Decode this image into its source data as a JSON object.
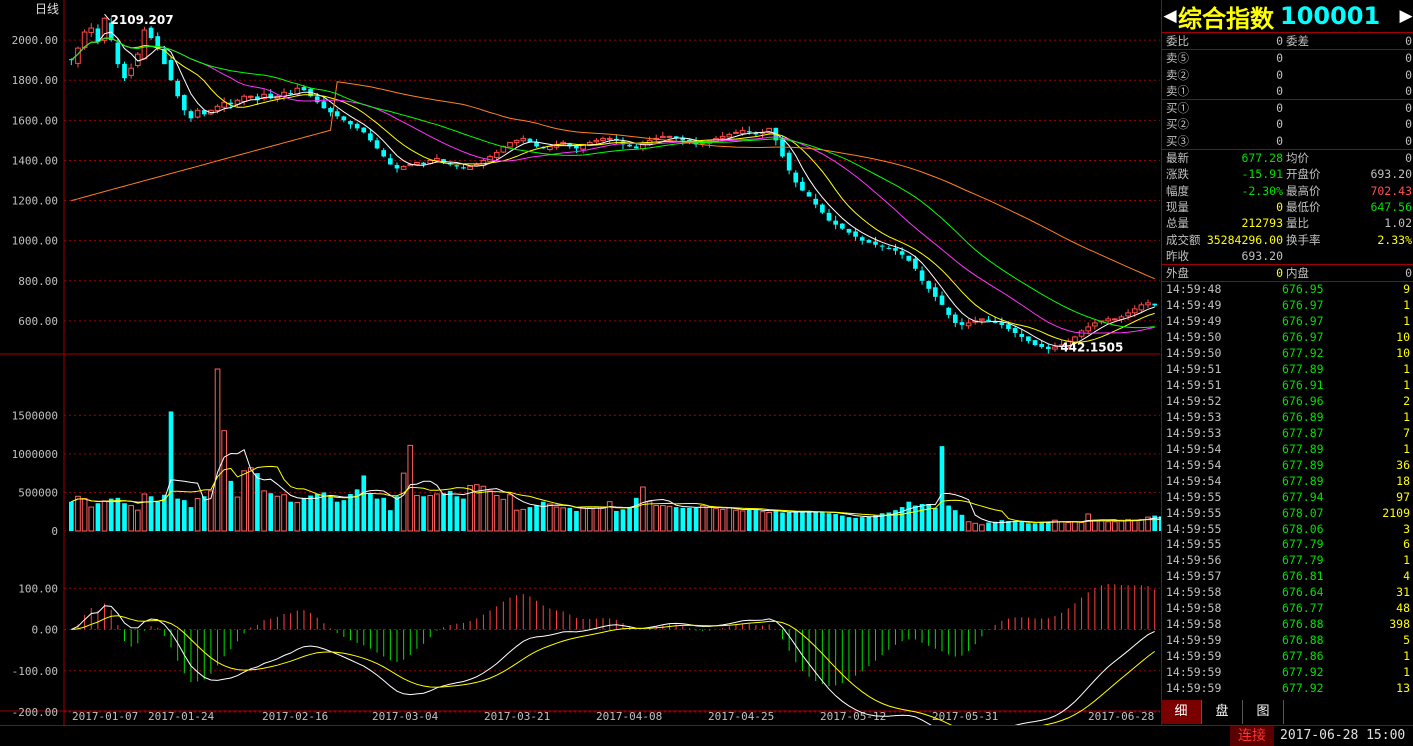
{
  "header": {
    "period_label": "日线"
  },
  "quote": {
    "title": "综合指数",
    "code": "100001",
    "arrow_left": "◀",
    "arrow_right": "▶",
    "order_ratio": {
      "label1": "委比",
      "value1": "0",
      "label2": "委差",
      "value2": "0"
    },
    "sell": [
      {
        "label": "卖⑤",
        "price": "0",
        "volume": "0"
      },
      {
        "label": "卖②",
        "price": "0",
        "volume": "0"
      },
      {
        "label": "卖①",
        "price": "0",
        "volume": "0"
      }
    ],
    "buy": [
      {
        "label": "买①",
        "price": "0",
        "volume": "0"
      },
      {
        "label": "买②",
        "price": "0",
        "volume": "0"
      },
      {
        "label": "买③",
        "price": "0",
        "volume": "0"
      }
    ],
    "stats": [
      {
        "label1": "最新",
        "value1": "677.28",
        "c1": "g",
        "label2": "均价",
        "value2": "0",
        "c2": "w"
      },
      {
        "label1": "涨跌",
        "value1": "-15.91",
        "c1": "g",
        "label2": "开盘价",
        "value2": "693.20",
        "c2": "w"
      },
      {
        "label1": "幅度",
        "value1": "-2.30%",
        "c1": "g",
        "label2": "最高价",
        "value2": "702.43",
        "c2": "r"
      },
      {
        "label1": "现量",
        "value1": "0",
        "c1": "y",
        "label2": "最低价",
        "value2": "647.56",
        "c2": "g"
      },
      {
        "label1": "总量",
        "value1": "212793",
        "c1": "y",
        "label2": "量比",
        "value2": "1.02",
        "c2": "w"
      },
      {
        "label1": "成交额",
        "value1": "35284296.00",
        "c1": "y",
        "label2": "换手率",
        "value2": "2.33%",
        "c2": "y"
      },
      {
        "label1": "昨收",
        "value1": "693.20",
        "c1": "w",
        "label2": "",
        "value2": "",
        "c2": "w"
      }
    ],
    "outer": {
      "label1": "外盘",
      "value1": "0",
      "label2": "内盘",
      "value2": "0"
    }
  },
  "ticks": [
    {
      "time": "14:59:48",
      "price": "676.95",
      "volume": "9"
    },
    {
      "time": "14:59:49",
      "price": "676.97",
      "volume": "1"
    },
    {
      "time": "14:59:49",
      "price": "676.97",
      "volume": "1"
    },
    {
      "time": "14:59:50",
      "price": "676.97",
      "volume": "10"
    },
    {
      "time": "14:59:50",
      "price": "677.92",
      "volume": "10"
    },
    {
      "time": "14:59:51",
      "price": "677.89",
      "volume": "1"
    },
    {
      "time": "14:59:51",
      "price": "676.91",
      "volume": "1"
    },
    {
      "time": "14:59:52",
      "price": "676.96",
      "volume": "2"
    },
    {
      "time": "14:59:53",
      "price": "676.89",
      "volume": "1"
    },
    {
      "time": "14:59:53",
      "price": "677.87",
      "volume": "7"
    },
    {
      "time": "14:59:54",
      "price": "677.89",
      "volume": "1"
    },
    {
      "time": "14:59:54",
      "price": "677.89",
      "volume": "36"
    },
    {
      "time": "14:59:54",
      "price": "677.89",
      "volume": "18"
    },
    {
      "time": "14:59:55",
      "price": "677.94",
      "volume": "97"
    },
    {
      "time": "14:59:55",
      "price": "678.07",
      "volume": "2109"
    },
    {
      "time": "14:59:55",
      "price": "678.06",
      "volume": "3"
    },
    {
      "time": "14:59:55",
      "price": "677.79",
      "volume": "6"
    },
    {
      "time": "14:59:56",
      "price": "677.79",
      "volume": "1"
    },
    {
      "time": "14:59:57",
      "price": "676.81",
      "volume": "4"
    },
    {
      "time": "14:59:58",
      "price": "676.64",
      "volume": "31"
    },
    {
      "time": "14:59:58",
      "price": "676.77",
      "volume": "48"
    },
    {
      "time": "14:59:58",
      "price": "676.88",
      "volume": "398"
    },
    {
      "time": "14:59:59",
      "price": "676.88",
      "volume": "5"
    },
    {
      "time": "14:59:59",
      "price": "677.86",
      "volume": "1"
    },
    {
      "time": "14:59:59",
      "price": "677.92",
      "volume": "1"
    },
    {
      "time": "14:59:59",
      "price": "677.92",
      "volume": "13"
    }
  ],
  "tabs": [
    {
      "label": "细",
      "active": true
    },
    {
      "label": "盘",
      "active": false
    },
    {
      "label": "图",
      "active": false
    }
  ],
  "status": {
    "connection": "连接",
    "datetime": "2017-06-28 15:00"
  },
  "chart_data": {
    "type": "candlestick",
    "date_labels": [
      "2017-01-07",
      "2017-01-24",
      "2017-02-16",
      "2017-03-04",
      "2017-03-21",
      "2017-04-08",
      "2017-04-25",
      "2017-05-12",
      "2017-05-31",
      "2017-06-28"
    ],
    "price": {
      "yticks": [
        "2000.00",
        "1800.00",
        "1600.00",
        "1400.00",
        "1200.00",
        "1000.00",
        "800.00",
        "600.00"
      ],
      "ylim": [
        450,
        2160
      ],
      "max_label": "2109.207",
      "min_label": "442.1505",
      "closes": [
        1900,
        1960,
        2040,
        2060,
        1990,
        2109,
        2000,
        1880,
        1810,
        1860,
        1930,
        2050,
        2010,
        1960,
        1880,
        1800,
        1720,
        1650,
        1610,
        1650,
        1630,
        1650,
        1670,
        1690,
        1680,
        1700,
        1720,
        1720,
        1700,
        1730,
        1710,
        1720,
        1740,
        1730,
        1760,
        1750,
        1720,
        1690,
        1660,
        1640,
        1620,
        1600,
        1580,
        1560,
        1540,
        1500,
        1460,
        1420,
        1380,
        1360,
        1370,
        1380,
        1390,
        1380,
        1400,
        1410,
        1390,
        1380,
        1370,
        1360,
        1370,
        1380,
        1400,
        1420,
        1440,
        1470,
        1490,
        1500,
        1510,
        1490,
        1470,
        1460,
        1470,
        1480,
        1490,
        1470,
        1460,
        1480,
        1490,
        1500,
        1510,
        1510,
        1500,
        1480,
        1470,
        1460,
        1480,
        1500,
        1510,
        1520,
        1520,
        1510,
        1500,
        1490,
        1480,
        1490,
        1500,
        1510,
        1520,
        1530,
        1540,
        1550,
        1540,
        1530,
        1540,
        1560,
        1500,
        1420,
        1350,
        1290,
        1250,
        1220,
        1180,
        1140,
        1100,
        1080,
        1060,
        1040,
        1020,
        1000,
        990,
        980,
        970,
        960,
        950,
        930,
        900,
        860,
        800,
        760,
        720,
        680,
        630,
        590,
        580,
        590,
        600,
        610,
        600,
        590,
        580,
        560,
        540,
        520,
        500,
        480,
        470,
        460,
        470,
        480,
        500,
        520,
        550,
        570,
        590,
        600,
        610,
        610,
        620,
        640,
        660,
        680,
        690,
        677
      ]
    },
    "volume": {
      "yticks": [
        "1500000",
        "1000000",
        "500000",
        "0"
      ],
      "ylim": [
        0,
        2100000
      ],
      "values": [
        380000,
        450000,
        420000,
        310000,
        360000,
        390000,
        420000,
        430000,
        360000,
        330000,
        270000,
        480000,
        450000,
        380000,
        470000,
        1550000,
        420000,
        400000,
        310000,
        420000,
        450000,
        520000,
        2100000,
        1300000,
        650000,
        440000,
        780000,
        820000,
        750000,
        520000,
        490000,
        450000,
        470000,
        380000,
        370000,
        430000,
        460000,
        480000,
        500000,
        440000,
        380000,
        400000,
        480000,
        540000,
        720000,
        480000,
        420000,
        430000,
        270000,
        450000,
        750000,
        1110000,
        460000,
        450000,
        460000,
        480000,
        490000,
        520000,
        450000,
        420000,
        590000,
        600000,
        580000,
        520000,
        460000,
        410000,
        470000,
        270000,
        280000,
        310000,
        330000,
        380000,
        350000,
        310000,
        300000,
        300000,
        260000,
        300000,
        300000,
        310000,
        300000,
        380000,
        260000,
        280000,
        300000,
        430000,
        570000,
        380000,
        330000,
        330000,
        320000,
        310000,
        300000,
        300000,
        300000,
        330000,
        310000,
        290000,
        280000,
        300000,
        270000,
        260000,
        280000,
        290000,
        250000,
        240000,
        260000,
        240000,
        240000,
        250000,
        240000,
        260000,
        240000,
        250000,
        230000,
        220000,
        200000,
        180000,
        170000,
        180000,
        190000,
        200000,
        230000,
        240000,
        270000,
        310000,
        380000,
        330000,
        350000,
        350000,
        300000,
        1100000,
        330000,
        270000,
        210000,
        120000,
        100000,
        80000,
        110000,
        120000,
        140000,
        130000,
        120000,
        120000,
        100000,
        100000,
        120000,
        120000,
        140000,
        120000,
        110000,
        120000,
        110000,
        220000,
        140000,
        130000,
        120000,
        120000,
        140000,
        150000,
        140000,
        150000,
        180000,
        200000,
        190000,
        230000,
        210000,
        180000
      ]
    },
    "macd": {
      "yticks": [
        "100.00",
        "0.00",
        "-100.00",
        "-200.00"
      ],
      "ylim": [
        -200,
        200
      ]
    }
  }
}
